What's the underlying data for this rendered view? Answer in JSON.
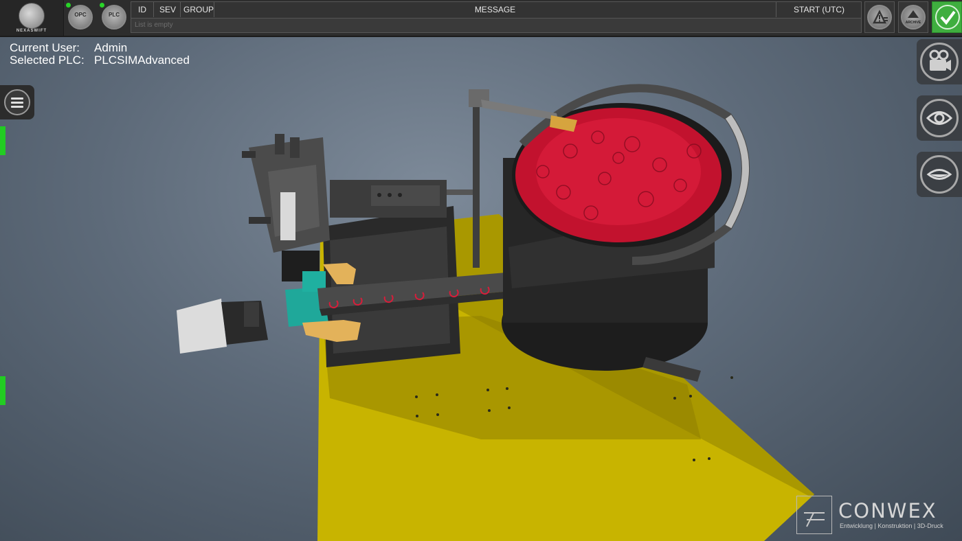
{
  "app": {
    "logo_text": "NEXASWIFT"
  },
  "connections": [
    {
      "label": "OPC",
      "status_color": "#28d428"
    },
    {
      "label": "PLC",
      "status_color": "#28d428"
    }
  ],
  "alarm_table": {
    "columns": [
      "ID",
      "SEV",
      "GROUP",
      "MESSAGE",
      "START (UTC)"
    ],
    "empty_text": "List is empty"
  },
  "toolbar": {
    "warning_icon": "warning-list-icon",
    "archive_label": "ARCHIVE",
    "confirm_icon": "checkmark-icon",
    "confirm_color": "#3fae3f"
  },
  "user_info": {
    "user_key": "Current User:",
    "user_value": "Admin",
    "plc_key": "Selected PLC:",
    "plc_value": "PLCSIMAdvanced"
  },
  "side_buttons": [
    "camera-icon",
    "eye-icon",
    "eye-closed-icon"
  ],
  "status_indicator_color": "#22cc22",
  "branding": {
    "name": "CONWEX",
    "tagline": "Entwicklung | Konstruktion | 3D-Druck"
  }
}
